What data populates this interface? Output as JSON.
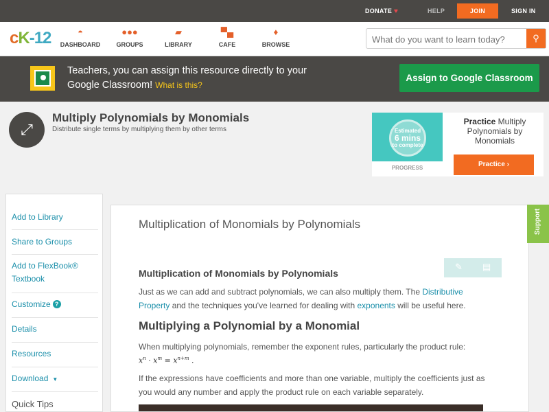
{
  "topbar": {
    "donate": "DONATE",
    "help": "HELP",
    "join": "JOIN",
    "signin": "SIGN IN"
  },
  "nav": {
    "logo_c": "c",
    "logo_k": "K",
    "logo_n": "-12",
    "items": [
      {
        "label": "DASHBOARD",
        "icon": "gauge-icon"
      },
      {
        "label": "GROUPS",
        "icon": "people-icon"
      },
      {
        "label": "LIBRARY",
        "icon": "book-icon"
      },
      {
        "label": "CAFE",
        "icon": "chat-icon"
      },
      {
        "label": "BROWSE",
        "icon": "lightbulb-icon"
      }
    ],
    "search_placeholder": "What do you want to learn today?"
  },
  "banner": {
    "text": "Teachers, you can assign this resource directly to your Google Classroom!",
    "what": "What is this?",
    "assign": "Assign to Google Classroom"
  },
  "header": {
    "title": "Multiply Polynomials by Monomials",
    "subtitle": "Distribute single terms by multiplying them by other terms"
  },
  "practice": {
    "estimated": "Estimated",
    "mins": "6 mins",
    "to_complete": "to complete",
    "progress": "PROGRESS",
    "practice_bold": "Practice",
    "practice_title": "Multiply Polynomials by Monomials",
    "button": "Practice"
  },
  "sidebar": {
    "items": [
      "Add to Library",
      "Share to Groups",
      "Add to FlexBook® Textbook",
      "Customize",
      "Details",
      "Resources",
      "Download"
    ],
    "quick_tips": "Quick Tips"
  },
  "content": {
    "title": "Multiplication of Monomials by Polynomials",
    "section_heading": "Multiplication of Monomials by Polynomials",
    "p1_a": "Just as we can add and subtract polynomials, we can also multiply them. The ",
    "p1_link1": "Distributive Property",
    "p1_b": " and the techniques you've learned for dealing with ",
    "p1_link2": "exponents",
    "p1_c": " will be useful here.",
    "heading2": "Multiplying a Polynomial by a Monomial",
    "p2": "When multiplying polynomials, remember the exponent rules, particularly the product rule:",
    "math": {
      "x1": "x",
      "n": "n",
      "dot": " · ",
      "x2": "x",
      "m": "m",
      "eq": " = ",
      "x3": "x",
      "nm": "n+m",
      "end": " ."
    },
    "p3": "If the expressions have coefficients and more than one variable, multiply the coefficients just as you would any number and apply the product rule on each variable separately."
  },
  "support": "Support",
  "colors": {
    "accent": "#f26b21",
    "dark": "#4a4845",
    "green": "#1b9a4a",
    "link": "#1b8faa",
    "support": "#8ac349"
  }
}
